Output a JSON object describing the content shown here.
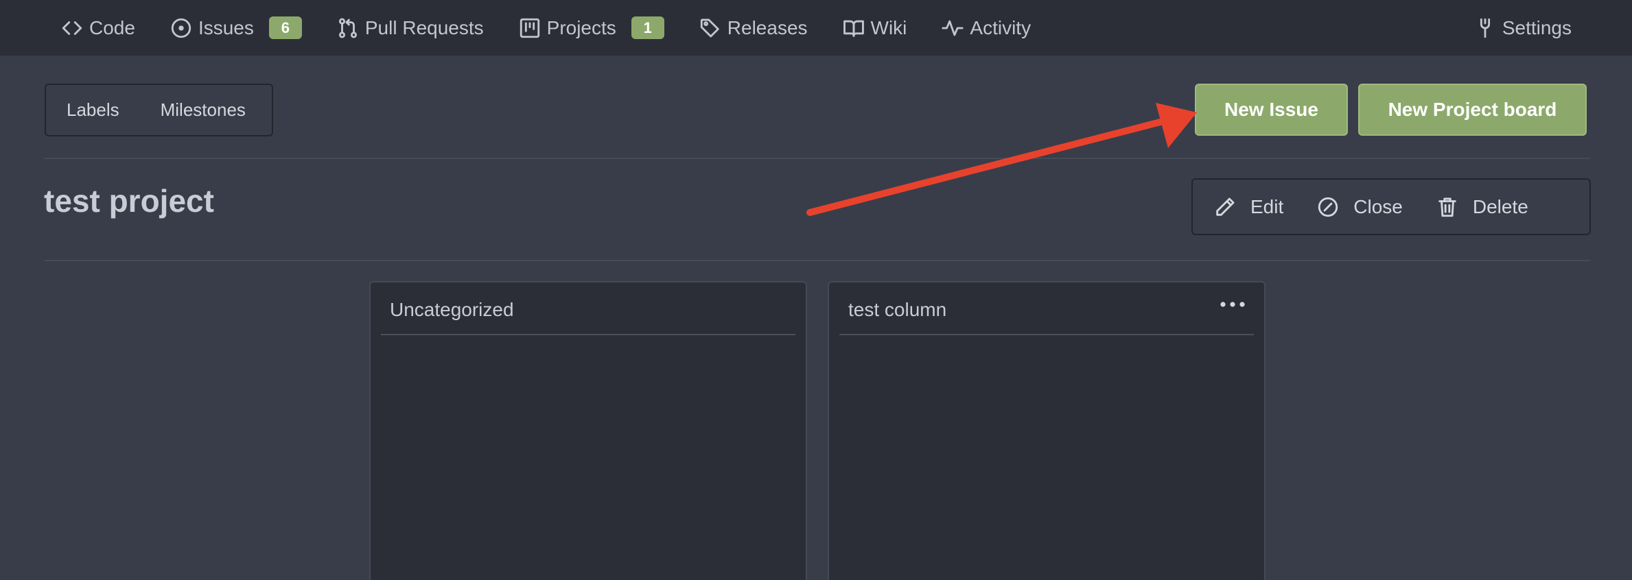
{
  "nav": {
    "items": [
      {
        "id": "code",
        "label": "Code",
        "icon": "code-icon"
      },
      {
        "id": "issues",
        "label": "Issues",
        "icon": "issue-opened-icon",
        "badge": "6"
      },
      {
        "id": "pulls",
        "label": "Pull Requests",
        "icon": "git-pull-request-icon"
      },
      {
        "id": "projects",
        "label": "Projects",
        "icon": "project-board-icon",
        "badge": "1"
      },
      {
        "id": "releases",
        "label": "Releases",
        "icon": "tag-icon"
      },
      {
        "id": "wiki",
        "label": "Wiki",
        "icon": "book-icon"
      },
      {
        "id": "activity",
        "label": "Activity",
        "icon": "pulse-icon"
      }
    ],
    "settings_label": "Settings"
  },
  "submenu": {
    "labels": "Labels",
    "milestones": "Milestones"
  },
  "buttons": {
    "new_issue": "New Issue",
    "new_project_board": "New Project board"
  },
  "project": {
    "title": "test project"
  },
  "actions": {
    "edit": "Edit",
    "close": "Close",
    "delete": "Delete"
  },
  "columns": [
    {
      "title": "Uncategorized"
    },
    {
      "title": "test column"
    }
  ],
  "colors": {
    "background": "#393d4a",
    "nav_background": "#2b2e37",
    "accent_green": "#8ca96b",
    "annotation_arrow": "#e8422d"
  }
}
